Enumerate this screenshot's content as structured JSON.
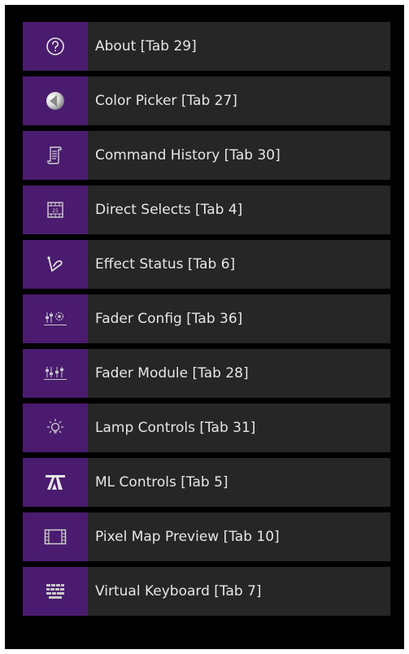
{
  "menu": {
    "items": [
      {
        "label": "About [Tab 29]",
        "icon": "help-circle-icon"
      },
      {
        "label": "Color Picker [Tab 27]",
        "icon": "color-sphere-icon"
      },
      {
        "label": "Command History [Tab 30]",
        "icon": "scroll-icon"
      },
      {
        "label": "Direct Selects [Tab 4]",
        "icon": "direct-select-grid-icon"
      },
      {
        "label": "Effect Status [Tab 6]",
        "icon": "effect-curve-icon"
      },
      {
        "label": "Fader Config [Tab 36]",
        "icon": "fader-config-icon"
      },
      {
        "label": "Fader Module [Tab 28]",
        "icon": "fader-module-icon"
      },
      {
        "label": "Lamp Controls [Tab 31]",
        "icon": "lamp-icon"
      },
      {
        "label": "ML Controls [Tab 5]",
        "icon": "moving-light-icon"
      },
      {
        "label": "Pixel Map Preview [Tab 10]",
        "icon": "film-frame-icon"
      },
      {
        "label": "Virtual Keyboard [Tab 7]",
        "icon": "keyboard-icon"
      }
    ]
  },
  "colors": {
    "icon_bg": "#4a1b6e",
    "label_bg": "#262626",
    "text": "#e6e6e6",
    "panel_bg": "#000000"
  },
  "icon_text": {
    "direct_select_number": "25"
  }
}
